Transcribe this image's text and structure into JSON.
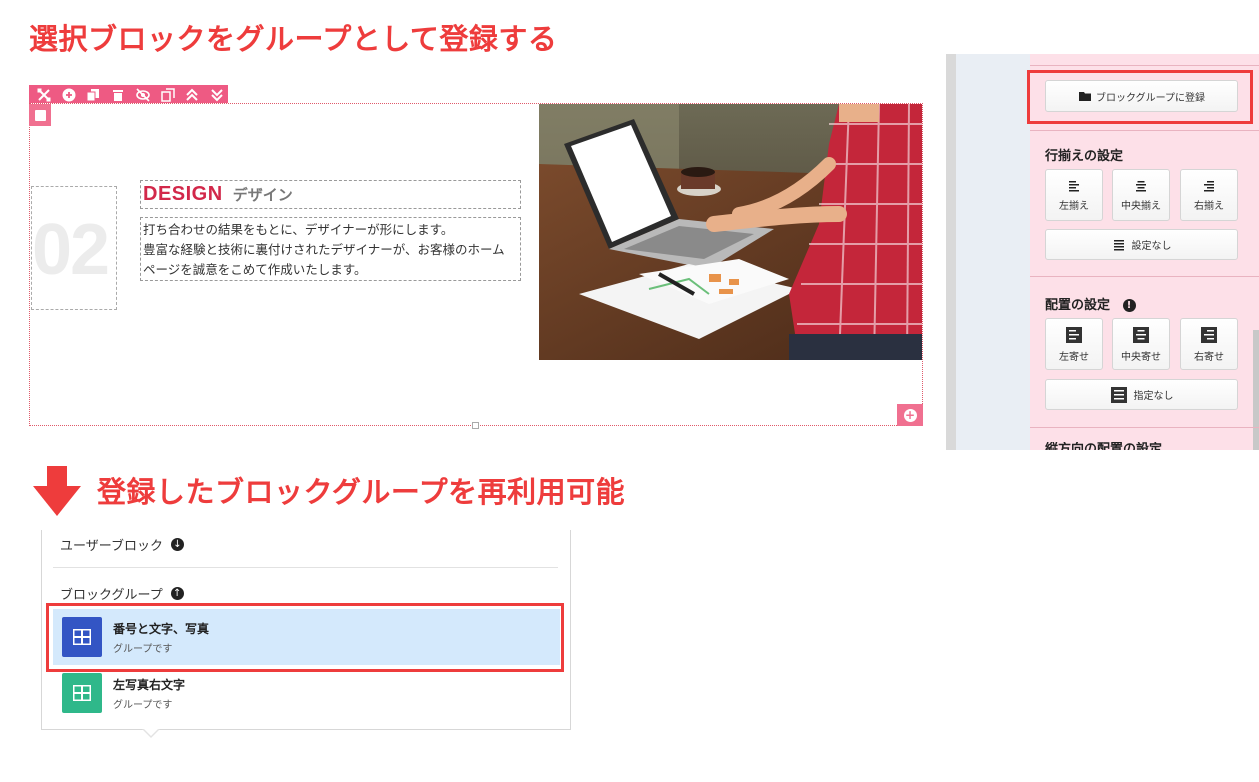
{
  "headings": {
    "top": "選択ブロックをグループとして登録する",
    "middle": "登録したブロックグループを再利用可能"
  },
  "toolbar": {
    "icons": [
      "move-icon",
      "add-circle-icon",
      "duplicate-icon",
      "trash-icon",
      "hide-icon",
      "copy-icon",
      "move-up-icon",
      "move-down-icon"
    ]
  },
  "block": {
    "number": "02",
    "title": "DESIGN",
    "subtitle": "デザイン",
    "body_lines": [
      "打ち合わせの結果をもとに、デザイナーが形にします。",
      "豊富な経験と技術に裏付けされたデザイナーが、お客様のホーム",
      "ページを誠意をこめて作成いたします。"
    ],
    "add_button": "+"
  },
  "panel": {
    "register_button": "ブロックグループに登録",
    "align_section": {
      "title": "行揃えの設定",
      "buttons": [
        "左揃え",
        "中央揃え",
        "右揃え"
      ],
      "none_button": "設定なし"
    },
    "placement_section": {
      "title": "配置の設定",
      "buttons": [
        "左寄せ",
        "中央寄せ",
        "右寄せ"
      ],
      "none_button": "指定なし"
    },
    "next_section_title": "縦方向の配置の設定"
  },
  "dropdown": {
    "user_block": "ユーザーブロック",
    "block_group": "ブロックグループ",
    "items": [
      {
        "name": "番号と文字、写真",
        "desc": "グループです",
        "color": "#3355c4",
        "selected": true
      },
      {
        "name": "左写真右文字",
        "desc": "グループです",
        "color": "#2fb88a",
        "selected": false
      }
    ]
  },
  "colors": {
    "accent_red": "#ee3c3c",
    "editor_pink": "#ee5a83",
    "panel_pink": "#fde0e8",
    "selected_blue": "#d4e9fc"
  }
}
